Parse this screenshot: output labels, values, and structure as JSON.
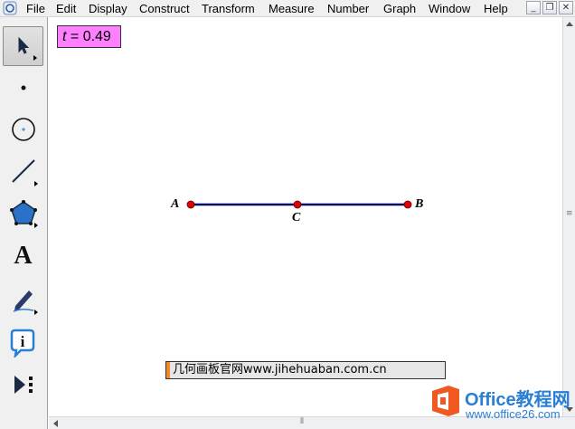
{
  "menu": {
    "items": [
      "File",
      "Edit",
      "Display",
      "Construct",
      "Transform",
      "Measure",
      "Number",
      "Graph",
      "Window",
      "Help"
    ]
  },
  "window_controls": {
    "minimize": "_",
    "restore": "❐",
    "close": "✕"
  },
  "toolbox": {
    "tools": [
      {
        "name": "selection-arrow-tool",
        "icon": "arrow-cursor-icon"
      },
      {
        "name": "point-tool",
        "icon": "point-icon"
      },
      {
        "name": "compass-tool",
        "icon": "circle-icon"
      },
      {
        "name": "straightedge-tool",
        "icon": "segment-icon"
      },
      {
        "name": "polygon-tool",
        "icon": "pentagon-icon"
      },
      {
        "name": "text-tool",
        "icon": "letter-a-icon"
      },
      {
        "name": "marker-tool",
        "icon": "pen-icon"
      },
      {
        "name": "information-tool",
        "icon": "info-icon"
      },
      {
        "name": "custom-tool",
        "icon": "play-menu-icon"
      }
    ],
    "text_tool_glyph": "A",
    "info_glyph": "i"
  },
  "parameter": {
    "variable": "t",
    "equals": " = ",
    "value": "0.49"
  },
  "geometry": {
    "segment_color": "#000066",
    "point_color": "#e00000",
    "points": [
      {
        "label": "A"
      },
      {
        "label": "C"
      },
      {
        "label": "B"
      }
    ]
  },
  "caption": {
    "text": "几何画板官网www.jihehuaban.com.cn"
  },
  "watermark": {
    "title": "Office教程网",
    "url": "www.office26.com"
  },
  "colors": {
    "param_bg": "#ff80ff",
    "accent": "#2a7fd4",
    "logo_orange": "#f05a22"
  }
}
